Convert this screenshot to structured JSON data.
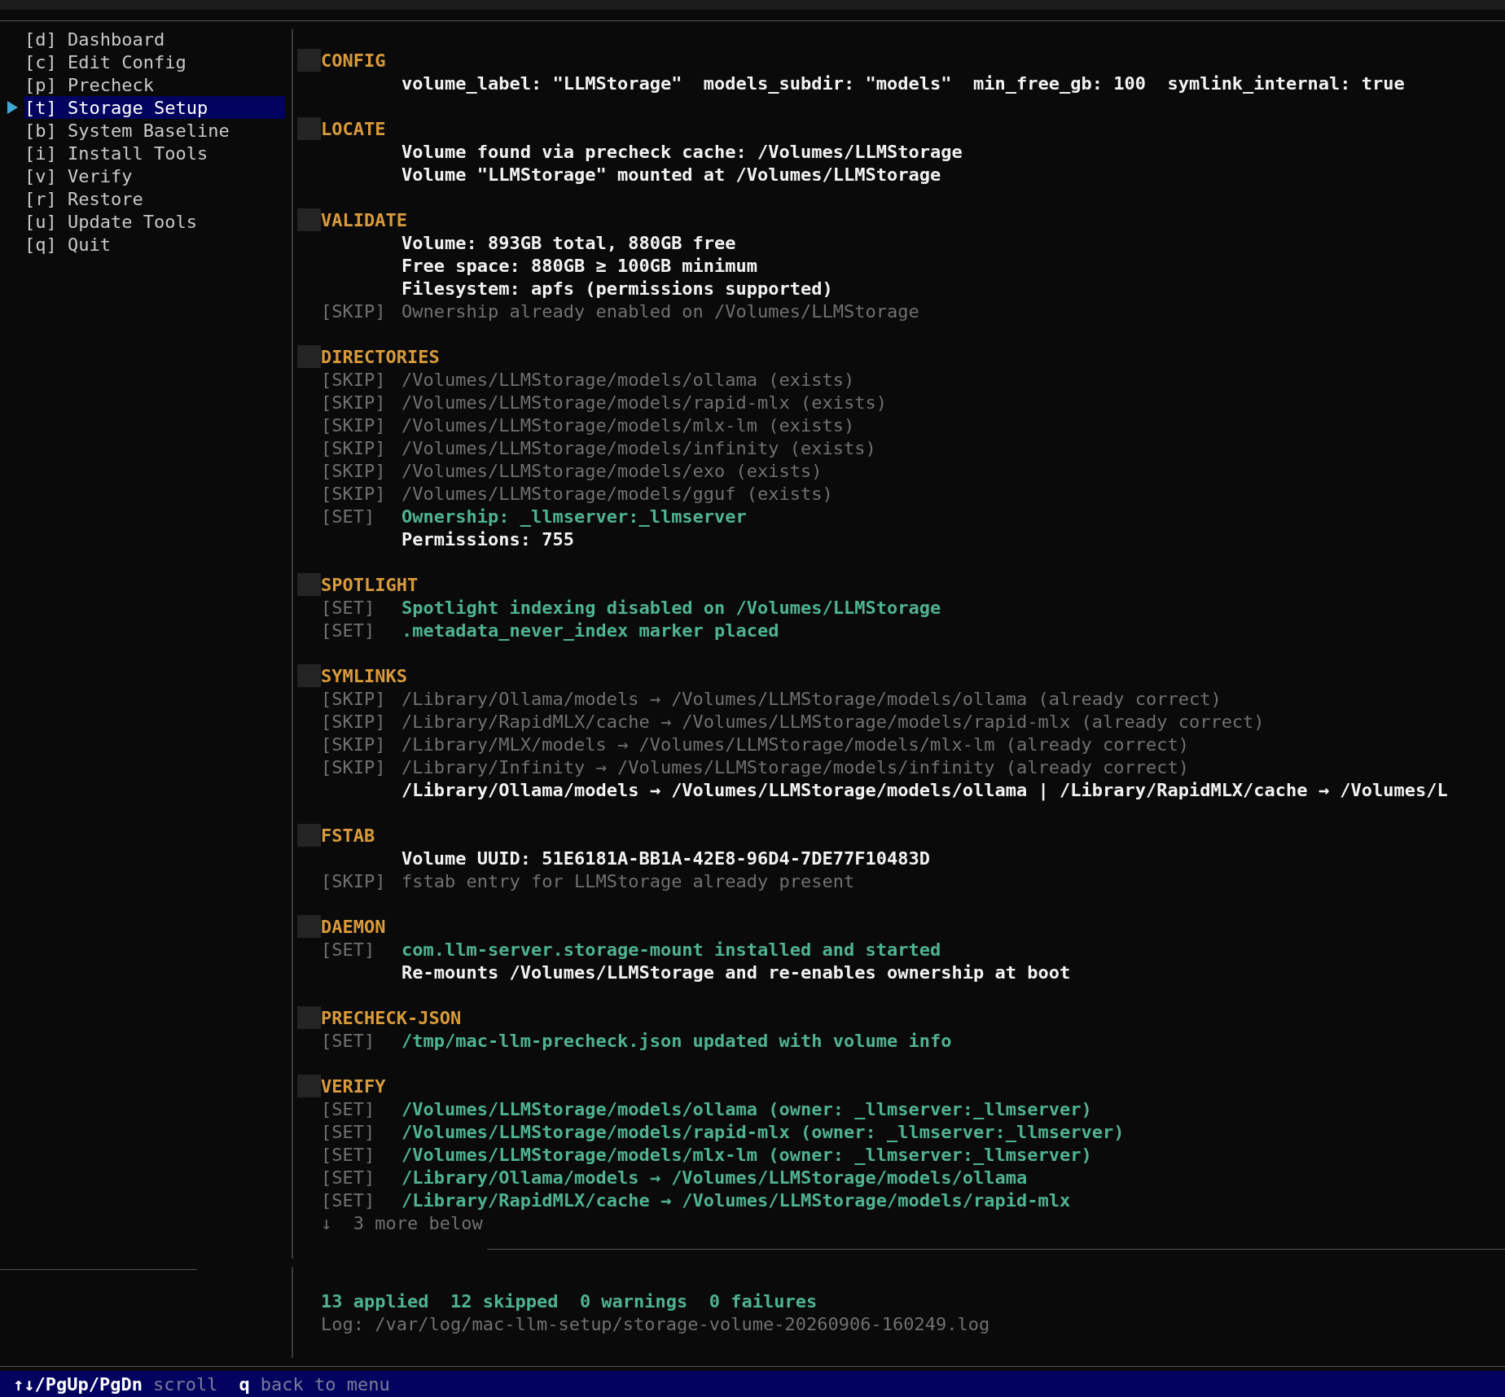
{
  "sidebar": {
    "items": [
      {
        "key": "[d]",
        "label": "Dashboard",
        "selected": false
      },
      {
        "key": "[c]",
        "label": "Edit Config",
        "selected": false
      },
      {
        "key": "[p]",
        "label": "Precheck",
        "selected": false
      },
      {
        "key": "[t]",
        "label": "Storage Setup",
        "selected": true
      },
      {
        "key": "[b]",
        "label": "System Baseline",
        "selected": false
      },
      {
        "key": "[i]",
        "label": "Install Tools",
        "selected": false
      },
      {
        "key": "[v]",
        "label": "Verify",
        "selected": false
      },
      {
        "key": "[r]",
        "label": "Restore",
        "selected": false
      },
      {
        "key": "[u]",
        "label": "Update Tools",
        "selected": false
      },
      {
        "key": "[q]",
        "label": "Quit",
        "selected": false
      }
    ]
  },
  "sections": [
    {
      "title": "CONFIG",
      "lines": [
        {
          "kind": "info",
          "text": "volume_label: \"LLMStorage\"  models_subdir: \"models\"  min_free_gb: 100  symlink_internal: true"
        }
      ]
    },
    {
      "title": "LOCATE",
      "lines": [
        {
          "kind": "info",
          "text": "Volume found via precheck cache: /Volumes/LLMStorage"
        },
        {
          "kind": "info",
          "text": "Volume \"LLMStorage\" mounted at /Volumes/LLMStorage"
        }
      ]
    },
    {
      "title": "VALIDATE",
      "lines": [
        {
          "kind": "info",
          "text": "Volume: 893GB total, 880GB free"
        },
        {
          "kind": "info",
          "text": "Free space: 880GB ≥ 100GB minimum"
        },
        {
          "kind": "info",
          "text": "Filesystem: apfs (permissions supported)"
        },
        {
          "kind": "skip",
          "tag": "[SKIP]",
          "text": "Ownership already enabled on /Volumes/LLMStorage"
        }
      ]
    },
    {
      "title": "DIRECTORIES",
      "lines": [
        {
          "kind": "skip",
          "tag": "[SKIP]",
          "text": "/Volumes/LLMStorage/models/ollama (exists)"
        },
        {
          "kind": "skip",
          "tag": "[SKIP]",
          "text": "/Volumes/LLMStorage/models/rapid-mlx (exists)"
        },
        {
          "kind": "skip",
          "tag": "[SKIP]",
          "text": "/Volumes/LLMStorage/models/mlx-lm (exists)"
        },
        {
          "kind": "skip",
          "tag": "[SKIP]",
          "text": "/Volumes/LLMStorage/models/infinity (exists)"
        },
        {
          "kind": "skip",
          "tag": "[SKIP]",
          "text": "/Volumes/LLMStorage/models/exo (exists)"
        },
        {
          "kind": "skip",
          "tag": "[SKIP]",
          "text": "/Volumes/LLMStorage/models/gguf (exists)"
        },
        {
          "kind": "set",
          "tag": "[SET]",
          "text": "Ownership: _llmserver:_llmserver"
        },
        {
          "kind": "info",
          "text": "Permissions: 755"
        }
      ]
    },
    {
      "title": "SPOTLIGHT",
      "lines": [
        {
          "kind": "set",
          "tag": "[SET]",
          "text": "Spotlight indexing disabled on /Volumes/LLMStorage"
        },
        {
          "kind": "set",
          "tag": "[SET]",
          "text": ".metadata_never_index marker placed"
        }
      ]
    },
    {
      "title": "SYMLINKS",
      "lines": [
        {
          "kind": "skip",
          "tag": "[SKIP]",
          "text": "/Library/Ollama/models → /Volumes/LLMStorage/models/ollama (already correct)"
        },
        {
          "kind": "skip",
          "tag": "[SKIP]",
          "text": "/Library/RapidMLX/cache → /Volumes/LLMStorage/models/rapid-mlx (already correct)"
        },
        {
          "kind": "skip",
          "tag": "[SKIP]",
          "text": "/Library/MLX/models → /Volumes/LLMStorage/models/mlx-lm (already correct)"
        },
        {
          "kind": "skip",
          "tag": "[SKIP]",
          "text": "/Library/Infinity → /Volumes/LLMStorage/models/infinity (already correct)"
        },
        {
          "kind": "info",
          "text": "/Library/Ollama/models → /Volumes/LLMStorage/models/ollama | /Library/RapidMLX/cache → /Volumes/L"
        }
      ]
    },
    {
      "title": "FSTAB",
      "lines": [
        {
          "kind": "info",
          "text": "Volume UUID: 51E6181A-BB1A-42E8-96D4-7DE77F10483D"
        },
        {
          "kind": "skip",
          "tag": "[SKIP]",
          "text": "fstab entry for LLMStorage already present"
        }
      ]
    },
    {
      "title": "DAEMON",
      "lines": [
        {
          "kind": "set",
          "tag": "[SET]",
          "text": "com.llm-server.storage-mount installed and started"
        },
        {
          "kind": "info",
          "text": "Re-mounts /Volumes/LLMStorage and re-enables ownership at boot"
        }
      ]
    },
    {
      "title": "PRECHECK-JSON",
      "lines": [
        {
          "kind": "set",
          "tag": "[SET]",
          "text": "/tmp/mac-llm-precheck.json updated with volume info"
        }
      ]
    },
    {
      "title": "VERIFY",
      "lines": [
        {
          "kind": "set",
          "tag": "[SET]",
          "text": "/Volumes/LLMStorage/models/ollama (owner: _llmserver:_llmserver)"
        },
        {
          "kind": "set",
          "tag": "[SET]",
          "text": "/Volumes/LLMStorage/models/rapid-mlx (owner: _llmserver:_llmserver)"
        },
        {
          "kind": "set",
          "tag": "[SET]",
          "text": "/Volumes/LLMStorage/models/mlx-lm (owner: _llmserver:_llmserver)"
        },
        {
          "kind": "set",
          "tag": "[SET]",
          "text": "/Library/Ollama/models → /Volumes/LLMStorage/models/ollama"
        },
        {
          "kind": "set",
          "tag": "[SET]",
          "text": "/Library/RapidMLX/cache → /Volumes/LLMStorage/models/rapid-mlx"
        }
      ]
    }
  ],
  "more_below": "↓  3 more below",
  "summary": {
    "counts": [
      "13 applied",
      "12 skipped",
      "0 warnings",
      "0 failures"
    ],
    "log": "Log: /var/log/mac-llm-setup/storage-volume-20260906-160249.log"
  },
  "status_bar": [
    {
      "key": "↑↓/PgUp/PgDn",
      "label": "scroll"
    },
    {
      "key": "q",
      "label": "back to menu"
    }
  ]
}
